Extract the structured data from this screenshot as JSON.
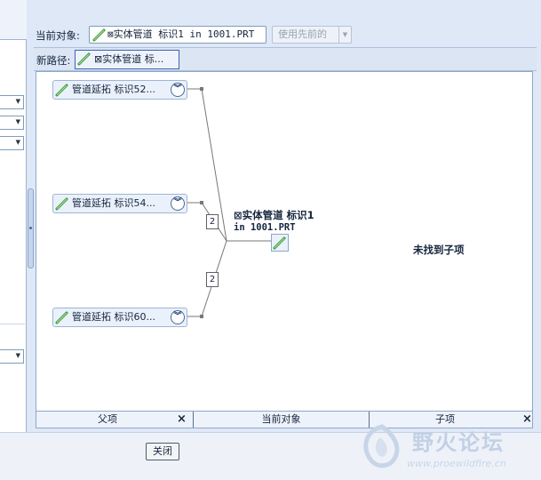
{
  "toolbar": {
    "current_object_label": "当前对象:",
    "current_object_value": "⊠实体管道 标识1 in 1001.PRT",
    "use_previous_label": "使用先前的"
  },
  "path_bar": {
    "label": "新路径:",
    "item": "⊠实体管道 标..."
  },
  "graph": {
    "parents": [
      {
        "label": "管道延拓 标识52..."
      },
      {
        "label": "管道延拓 标识54..."
      },
      {
        "label": "管道延拓 标识60..."
      }
    ],
    "connector_counts": [
      "2",
      "2"
    ],
    "current": {
      "line1": "⊠实体管道 标识1",
      "line2": "in 1001.PRT"
    },
    "no_children_text": "未找到子项"
  },
  "bottom_tabs": {
    "parents": "父项",
    "current": "当前对象",
    "children": "子项",
    "close_glyph": "×"
  },
  "footer": {
    "close_button": "关闭"
  },
  "watermark": {
    "title": "野火论坛",
    "url": "www.proewildfire.cn"
  },
  "icons": {
    "part_icon": "pencil-feature-icon",
    "expand_icon": "double-chevron-down-icon"
  },
  "colors": {
    "accent": "#3c64b4",
    "panel": "#dfe8f6",
    "node_bg": "#eaf1fb"
  }
}
